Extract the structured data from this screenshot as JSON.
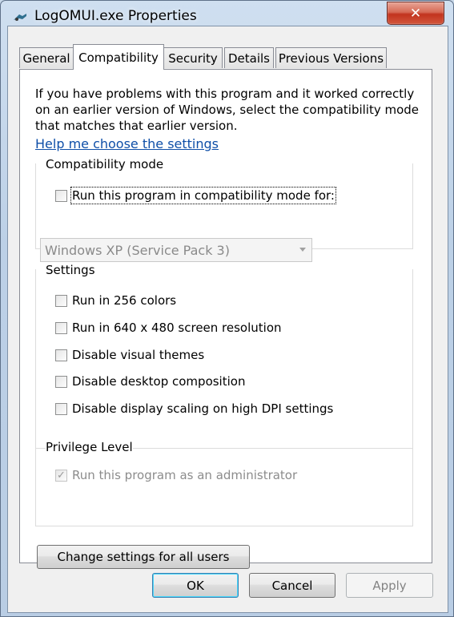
{
  "window": {
    "title": "LogOMUI.exe Properties",
    "close_glyph": "✕"
  },
  "tabs": [
    {
      "label": "General"
    },
    {
      "label": "Compatibility"
    },
    {
      "label": "Security"
    },
    {
      "label": "Details"
    },
    {
      "label": "Previous Versions"
    }
  ],
  "active_tab": "Compatibility",
  "intro": {
    "text": "If you have problems with this program and it worked correctly on an earlier version of Windows, select the compatibility mode that matches that earlier version.",
    "help_link": "Help me choose the settings"
  },
  "compat_mode": {
    "label": "Compatibility mode",
    "checkbox_label": "Run this program in compatibility mode for:",
    "checked": false,
    "dropdown_value": "Windows XP (Service Pack 3)"
  },
  "settings": {
    "label": "Settings",
    "items": [
      {
        "label": "Run in 256 colors",
        "checked": false
      },
      {
        "label": "Run in 640 x 480 screen resolution",
        "checked": false
      },
      {
        "label": "Disable visual themes",
        "checked": false
      },
      {
        "label": "Disable desktop composition",
        "checked": false
      },
      {
        "label": "Disable display scaling on high DPI settings",
        "checked": false
      }
    ]
  },
  "privilege": {
    "label": "Privilege Level",
    "checkbox_label": "Run this program as an administrator",
    "checked": true,
    "check_glyph": "✓"
  },
  "buttons": {
    "change_all": "Change settings for all users",
    "ok": "OK",
    "cancel": "Cancel",
    "apply": "Apply"
  },
  "colors": {
    "link": "#0f4fa8",
    "close_button": "#c2331e",
    "default_button_border": "#3c7fb1"
  }
}
